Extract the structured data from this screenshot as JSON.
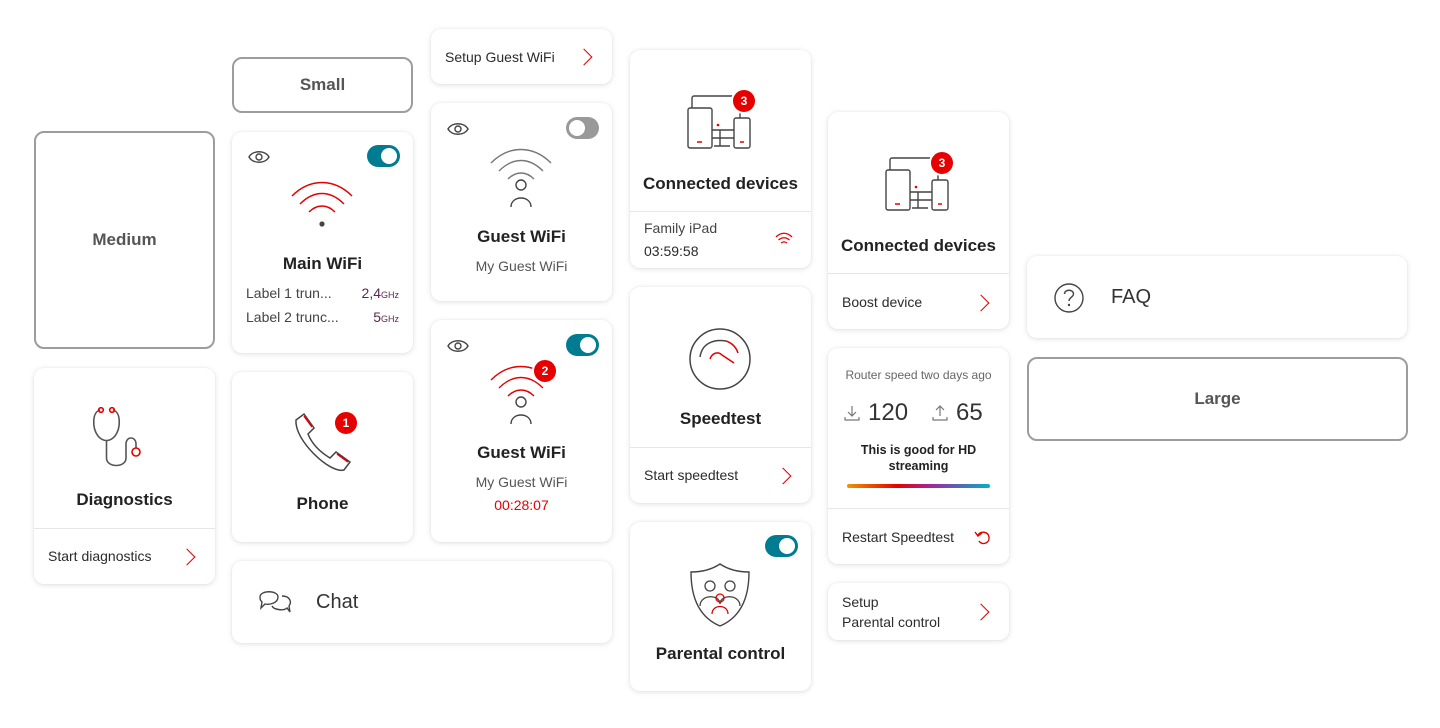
{
  "size_labels": {
    "small": "Small",
    "medium": "Medium",
    "large": "Large"
  },
  "main_wifi": {
    "title": "Main WiFi",
    "bands": [
      {
        "label": "Label 1 trun...",
        "value": "2,4",
        "unit": "GHz"
      },
      {
        "label": "Label 2 trunc...",
        "value": "5",
        "unit": "GHz"
      }
    ],
    "toggle_on": true
  },
  "guest_setup": {
    "label": "Setup Guest WiFi"
  },
  "guest_wifi_off": {
    "title": "Guest WiFi",
    "subtitle": "My Guest WiFi",
    "toggle_on": false
  },
  "guest_wifi_on": {
    "title": "Guest WiFi",
    "subtitle": "My Guest WiFi",
    "timer": "00:28:07",
    "badge": "2",
    "toggle_on": true
  },
  "diagnostics": {
    "title": "Diagnostics",
    "action": "Start diagnostics"
  },
  "phone": {
    "title": "Phone",
    "badge": "1"
  },
  "chat": {
    "label": "Chat"
  },
  "connected_small": {
    "title": "Connected devices",
    "badge": "3",
    "device_name": "Family iPad",
    "device_time": "03:59:58"
  },
  "speedtest": {
    "title": "Speedtest",
    "action": "Start speedtest"
  },
  "parental": {
    "title": "Parental control",
    "toggle_on": true
  },
  "connected_large": {
    "title": "Connected devices",
    "badge": "3",
    "action": "Boost device"
  },
  "router_speed": {
    "caption": "Router speed two days ago",
    "download": "120",
    "upload": "65",
    "quality": "This is good for HD streaming",
    "action": "Restart Speedtest"
  },
  "parental_setup": {
    "line1": "Setup",
    "line2": "Parental control"
  },
  "faq": {
    "label": "FAQ"
  },
  "colors": {
    "accent": "#e60000",
    "toggle_on": "#007c92",
    "toggle_off": "#999999"
  }
}
